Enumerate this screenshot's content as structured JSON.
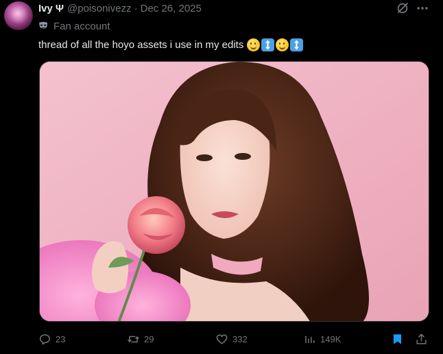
{
  "author": {
    "name": "Ivy",
    "badge": "Ψ",
    "handle": "@poisonivezz",
    "separator": "·",
    "date": "Dec 26, 2025"
  },
  "fan_label": "Fan account",
  "text": "thread of all the hoyo assets i use in my edits",
  "emojis": [
    "smiling-face",
    "up-down-arrow",
    "smiling-face",
    "up-down-arrow"
  ],
  "media": {
    "description_icon": "photo"
  },
  "actions": {
    "replies": "23",
    "reposts": "29",
    "likes": "332",
    "views": "149K"
  },
  "colors": {
    "background": "#000000",
    "text": "#e7e9ea",
    "muted": "#71767b",
    "accent": "#1d9bf0"
  }
}
